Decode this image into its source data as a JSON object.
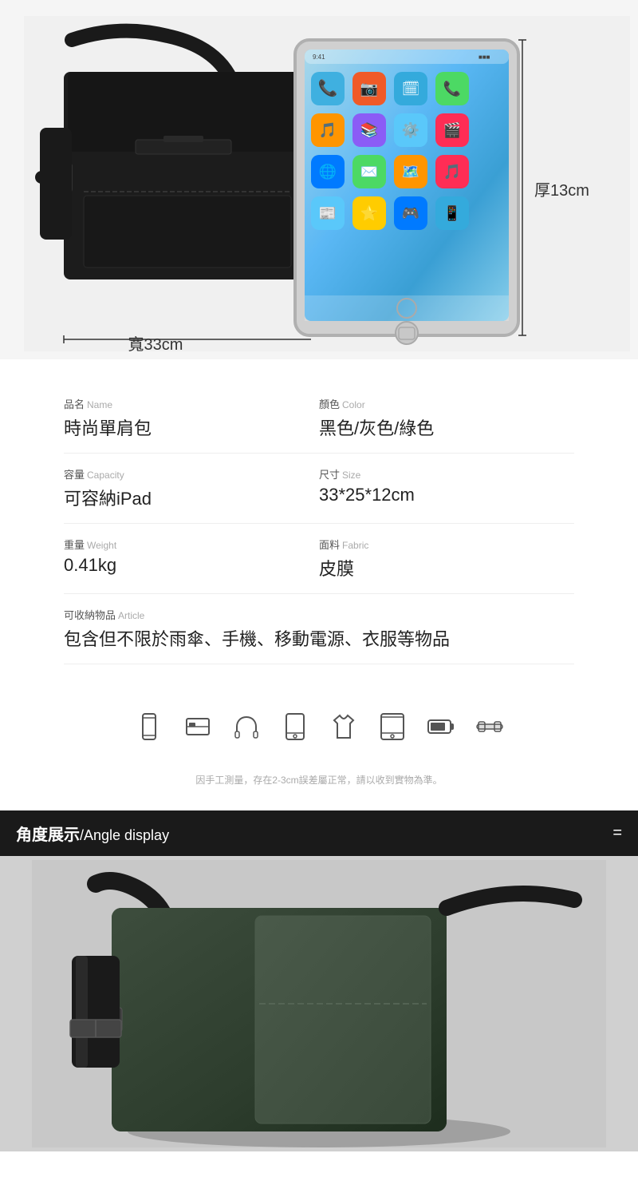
{
  "hero": {
    "dimension_width": "寬33cm",
    "dimension_thickness": "厚13cm"
  },
  "specs": {
    "name_label_cn": "品名",
    "name_label_en": "Name",
    "name_value": "時尚單肩包",
    "color_label_cn": "顏色",
    "color_label_en": "Color",
    "color_value": "黑色/灰色/綠色",
    "capacity_label_cn": "容量",
    "capacity_label_en": "Capacity",
    "capacity_value": "可容納iPad",
    "size_label_cn": "尺寸",
    "size_label_en": "Size",
    "size_value": "33*25*12cm",
    "weight_label_cn": "重量",
    "weight_label_en": "Weight",
    "weight_value": "0.41kg",
    "fabric_label_cn": "面料",
    "fabric_label_en": "Fabric",
    "fabric_value": "皮膜",
    "article_label_cn": "可收納物品",
    "article_label_en": "Article",
    "article_value": "包含但不限於雨傘、手機、移動電源、衣服等物品"
  },
  "icons": [
    {
      "name": "phone-icon",
      "label": "手機"
    },
    {
      "name": "card-icon",
      "label": "卡片"
    },
    {
      "name": "earphones-icon",
      "label": "耳機"
    },
    {
      "name": "tablet-icon",
      "label": "平板"
    },
    {
      "name": "shirt-icon",
      "label": "衣服"
    },
    {
      "name": "ipad-icon",
      "label": "iPad"
    },
    {
      "name": "battery-icon",
      "label": "電源"
    },
    {
      "name": "cable-icon",
      "label": "線"
    }
  ],
  "disclaimer": "因手工測量，存在2-3cm誤差屬正常，請以收到實物為準。",
  "angle_section": {
    "title_cn": "角度展示",
    "title_en": "/Angle display",
    "eq_symbol": "="
  },
  "colors": {
    "bg_dark": "#1a1a1a",
    "text_primary": "#222222",
    "text_secondary": "#888888",
    "accent": "#ffffff"
  }
}
